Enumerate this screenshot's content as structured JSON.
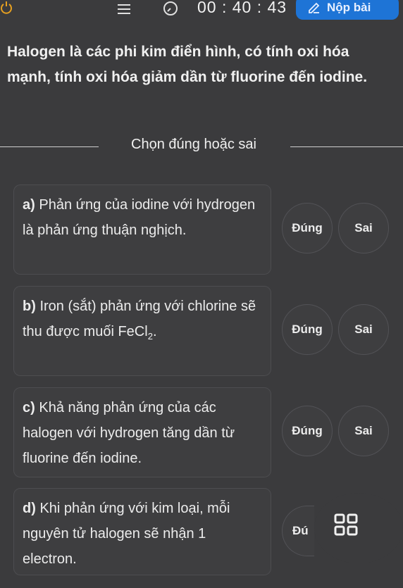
{
  "header": {
    "timer": "00 : 40 : 43",
    "submit_label": "Nộp bài"
  },
  "question": {
    "text": "Halogen là các phi kim điển hình, có tính oxi hóa mạnh, tính oxi hóa giảm dần từ fluorine đến iodine."
  },
  "divider": {
    "label": "Chọn đúng hoặc sai"
  },
  "statements": [
    {
      "letter": "a)",
      "text": "Phản ứng của iodine với hydrogen là phản ứng thuận nghịch.",
      "true_label": "Đúng",
      "false_label": "Sai"
    },
    {
      "letter": "b)",
      "text": "Iron (sắt) phản ứng với chlorine sẽ thu được muối",
      "formula_main": "FeCl",
      "formula_sub": "2",
      "formula_end": ".",
      "true_label": "Đúng",
      "false_label": "Sai"
    },
    {
      "letter": "c)",
      "text": "Khả năng phản ứng của các halogen với hydrogen tăng dần từ fluorine đến iodine.",
      "true_label": "Đúng",
      "false_label": "Sai"
    },
    {
      "letter": "d)",
      "text": "Khi phản ứng với kim loại, mỗi nguyên tử halogen sẽ nhận 1 electron.",
      "true_label": "Đú"
    }
  ],
  "icons": {
    "power": "power-icon",
    "list": "list-icon",
    "clock": "clock-icon",
    "submit": "edit-icon",
    "grid": "grid-icon"
  },
  "colors": {
    "background": "#3b3b3d",
    "accent": "#1e74d6",
    "text": "#e9e9e9"
  }
}
